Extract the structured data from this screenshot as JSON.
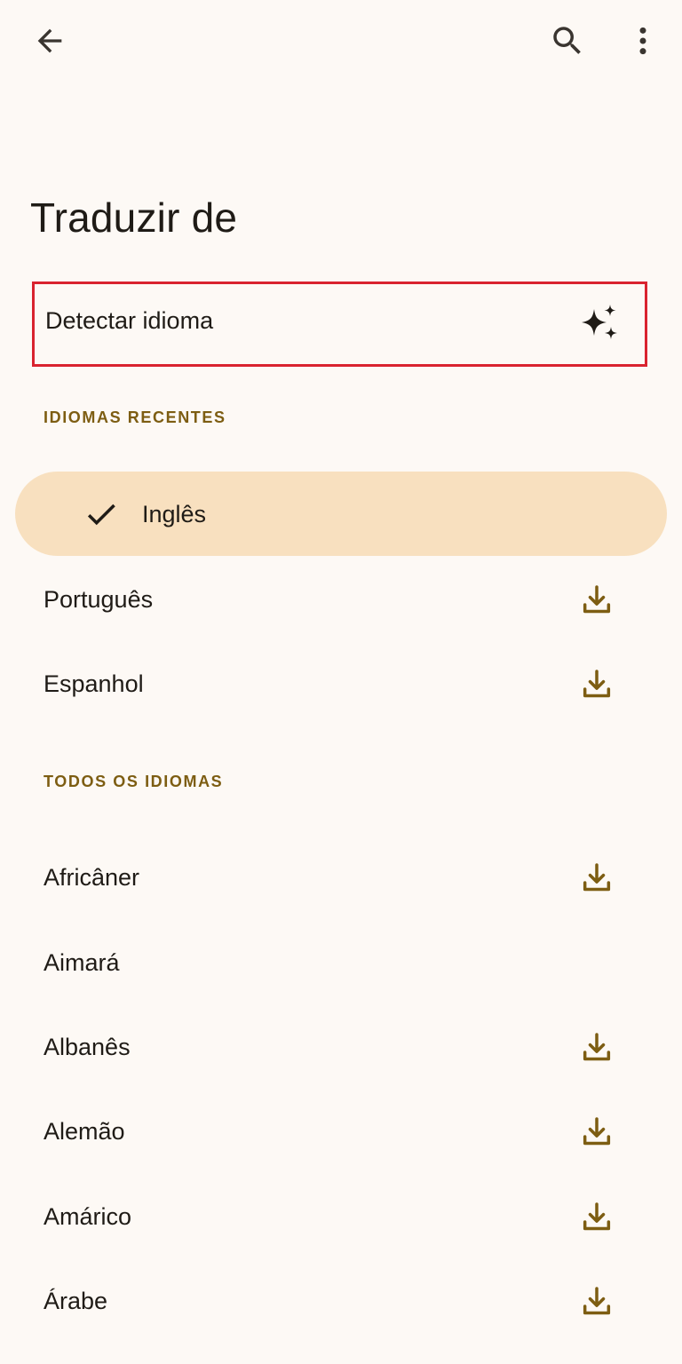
{
  "header": {
    "back_icon": "arrow-left-icon",
    "search_icon": "search-icon",
    "more_icon": "more-vertical-icon"
  },
  "title": "Traduzir de",
  "detect": {
    "label": "Detectar idioma",
    "icon": "sparkle-icon",
    "highlight_color": "#d9232f"
  },
  "recent": {
    "header": "IDIOMAS RECENTES",
    "selected": {
      "label": "Inglês",
      "icon": "check-icon"
    },
    "items": [
      {
        "label": "Português",
        "downloadable": true
      },
      {
        "label": "Espanhol",
        "downloadable": true
      }
    ]
  },
  "all": {
    "header": "TODOS OS IDIOMAS",
    "items": [
      {
        "label": "Africâner",
        "downloadable": true
      },
      {
        "label": "Aimará",
        "downloadable": false
      },
      {
        "label": "Albanês",
        "downloadable": true
      },
      {
        "label": "Alemão",
        "downloadable": true
      },
      {
        "label": "Amárico",
        "downloadable": true
      },
      {
        "label": "Árabe",
        "downloadable": true
      }
    ]
  },
  "colors": {
    "background": "#fdf9f5",
    "accent": "#7d5d12",
    "selected_bg": "#f8e0bf",
    "text": "#1f1b16"
  }
}
